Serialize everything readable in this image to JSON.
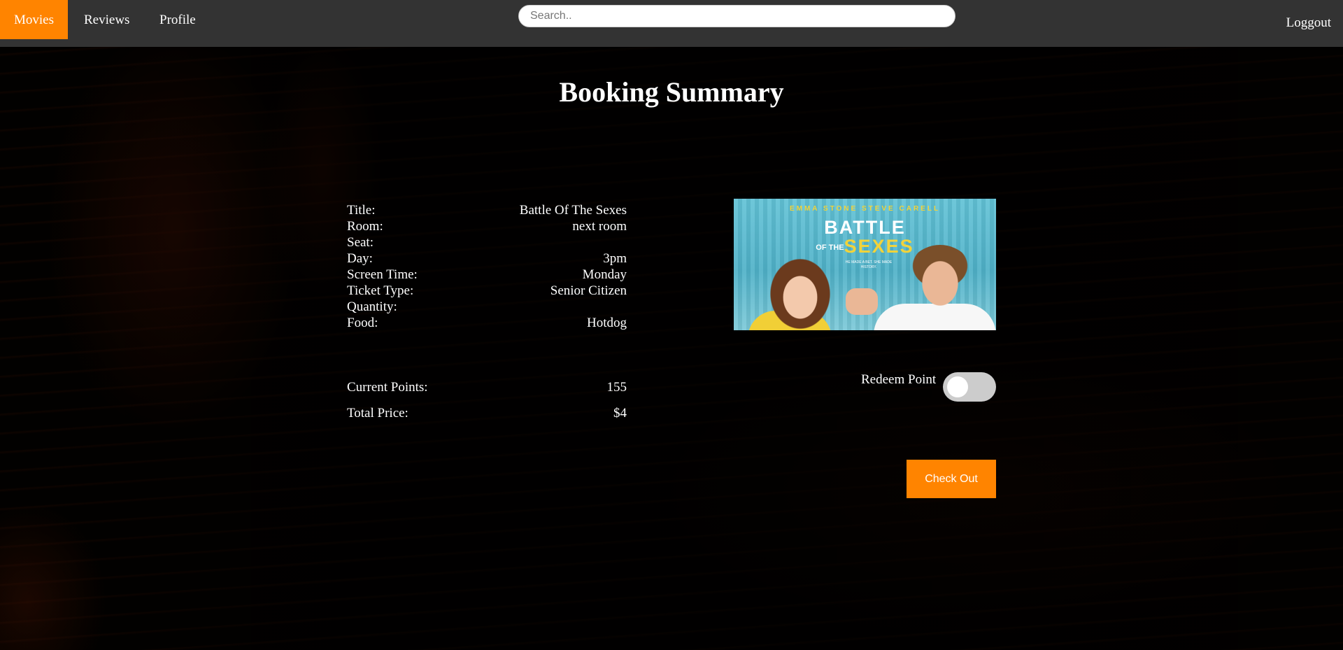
{
  "nav": {
    "items": [
      {
        "label": "Movies",
        "active": true
      },
      {
        "label": "Reviews",
        "active": false
      },
      {
        "label": "Profile",
        "active": false
      }
    ],
    "search_placeholder": "Search..",
    "logout_label": "Loggout"
  },
  "page": {
    "title": "Booking Summary"
  },
  "summary": {
    "rows": [
      {
        "label": "Title:",
        "value": "Battle Of The Sexes"
      },
      {
        "label": "Room:",
        "value": "next room"
      },
      {
        "label": "Seat:",
        "value": ""
      },
      {
        "label": "Day:",
        "value": "3pm"
      },
      {
        "label": "Screen Time:",
        "value": "Monday"
      },
      {
        "label": "Ticket Type:",
        "value": "Senior Citizen"
      },
      {
        "label": "Quantity:",
        "value": ""
      },
      {
        "label": "Food:",
        "value": "Hotdog"
      }
    ]
  },
  "points": {
    "current_label": "Current Points:",
    "current_value": "155",
    "total_label": "Total Price:",
    "total_value": "$4"
  },
  "poster": {
    "actors": "EMMA STONE   STEVE CARELL",
    "title_line1": "BATTLE",
    "title_of": "OF THE",
    "title_line2": "SEXES",
    "tagline": "HE MADE A BET. SHE MADE HISTORY."
  },
  "redeem": {
    "label": "Redeem Point",
    "enabled": false
  },
  "checkout_label": "Check Out",
  "colors": {
    "accent": "#ff8400",
    "navbar": "#333333",
    "toggle_off": "#cccccc"
  }
}
